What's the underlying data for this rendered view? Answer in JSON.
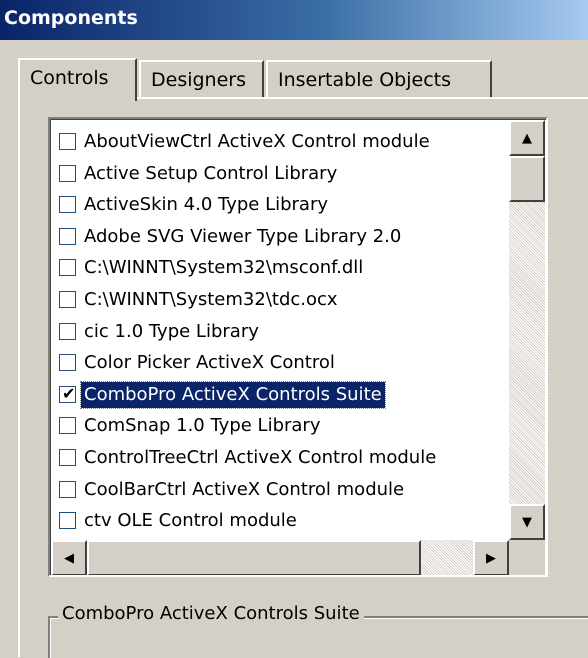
{
  "window": {
    "title": "Components"
  },
  "tabs": [
    {
      "label": "Controls",
      "active": true
    },
    {
      "label": "Designers",
      "active": false
    },
    {
      "label": "Insertable Objects",
      "active": false
    }
  ],
  "list": {
    "items": [
      {
        "label": "AboutViewCtrl ActiveX Control module",
        "checked": false
      },
      {
        "label": "Active Setup Control Library",
        "checked": false
      },
      {
        "label": "ActiveSkin 4.0 Type Library",
        "checked": false
      },
      {
        "label": "Adobe SVG Viewer Type Library 2.0",
        "checked": false
      },
      {
        "label": "C:\\WINNT\\System32\\msconf.dll",
        "checked": false
      },
      {
        "label": "C:\\WINNT\\System32\\tdc.ocx",
        "checked": false
      },
      {
        "label": "cic 1.0 Type Library",
        "checked": false
      },
      {
        "label": "Color Picker ActiveX Control",
        "checked": false
      },
      {
        "label": "ComboPro ActiveX Controls Suite",
        "checked": true,
        "selected": true
      },
      {
        "label": "ComSnap 1.0 Type Library",
        "checked": false
      },
      {
        "label": "ControlTreeCtrl ActiveX Control module",
        "checked": false
      },
      {
        "label": "CoolBarCtrl ActiveX Control module",
        "checked": false
      },
      {
        "label": "ctv OLE Control module",
        "checked": false
      }
    ],
    "check_glyph": "✔"
  },
  "scroll": {
    "up_arrow": "▲",
    "down_arrow": "▼",
    "left_arrow": "◀",
    "right_arrow": "▶"
  },
  "details": {
    "group_title": "ComboPro ActiveX Controls Suite"
  },
  "colors": {
    "selection": "#0a246a",
    "face": "#d4d0c8"
  }
}
